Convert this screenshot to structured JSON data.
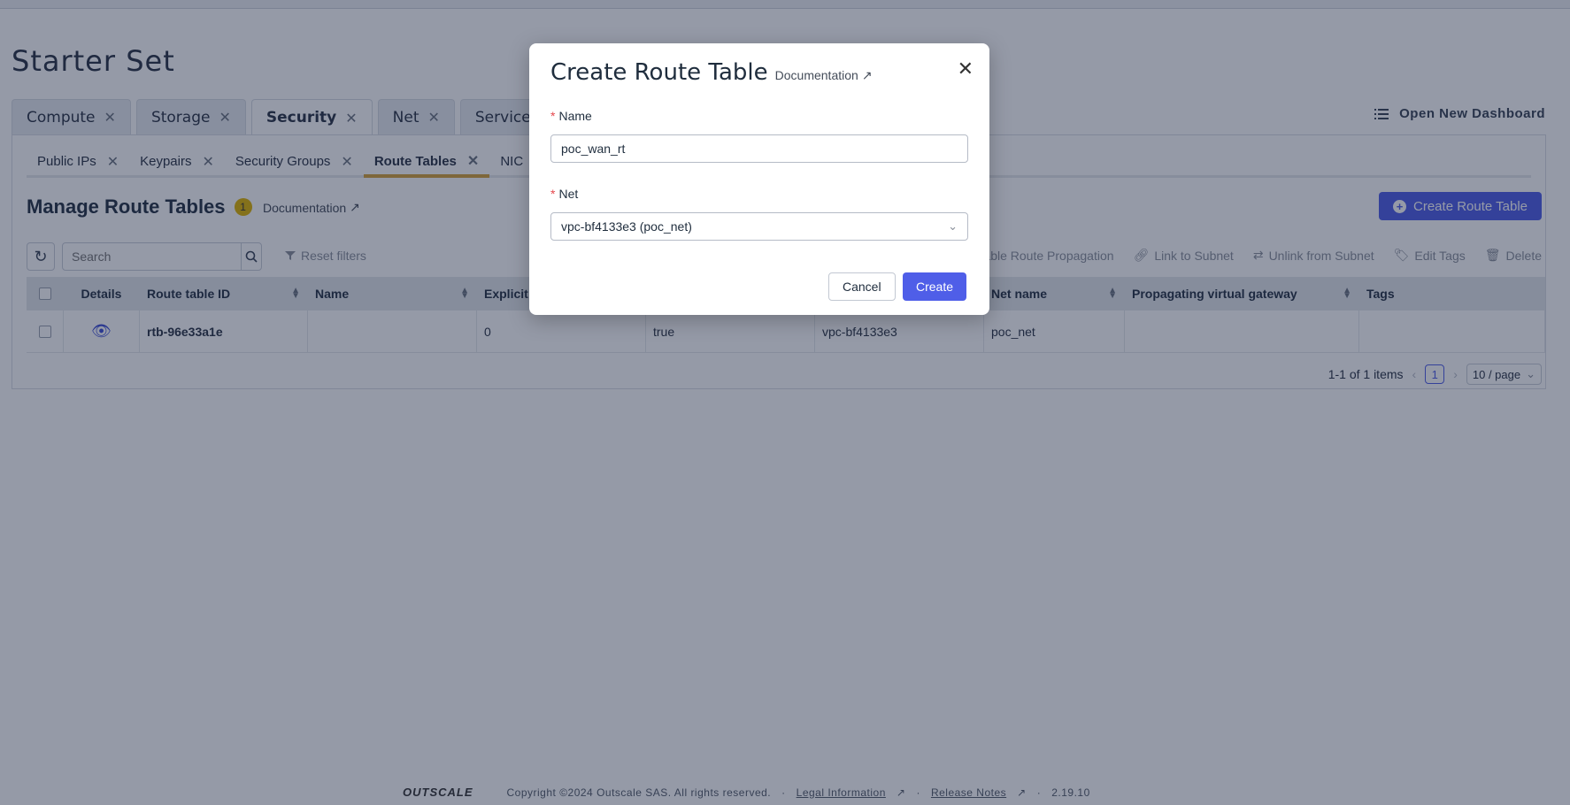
{
  "page": {
    "title": "Starter Set"
  },
  "dashboard_tabs": [
    {
      "label": "Compute"
    },
    {
      "label": "Storage"
    },
    {
      "label": "Security"
    },
    {
      "label": "Net"
    },
    {
      "label": "Services"
    }
  ],
  "open_new_dashboard": "Open New Dashboard",
  "sub_tabs": [
    {
      "label": "Public IPs"
    },
    {
      "label": "Keypairs"
    },
    {
      "label": "Security Groups"
    },
    {
      "label": "Route Tables"
    },
    {
      "label": "NIC"
    }
  ],
  "manage": {
    "title": "Manage Route Tables",
    "badge": "1",
    "documentation": "Documentation",
    "create_button": "Create Route Table"
  },
  "toolbar": {
    "search_placeholder": "Search",
    "reset_filters": "Reset filters",
    "actions": [
      "sable Route Propagation",
      "Link to Subnet",
      "Unlink from Subnet",
      "Edit Tags",
      "Delete"
    ]
  },
  "table": {
    "headers": [
      "Details",
      "Route table ID",
      "Name",
      "Explicit",
      "",
      "",
      "Net name",
      "Propagating virtual gateway",
      "Tags"
    ],
    "rows": [
      [
        "",
        "rtb-96e33a1e",
        "",
        "0",
        "true",
        "vpc-bf4133e3",
        "poc_net",
        "",
        ""
      ]
    ]
  },
  "pagination": {
    "summary": "1-1 of 1 items",
    "current": "1",
    "page_size": "10 / page"
  },
  "footer": {
    "logo": "OUTSCALE",
    "copyright": "Copyright ©2024 Outscale SAS. All rights reserved.",
    "legal": "Legal Information",
    "release": "Release Notes",
    "version": "2.19.10",
    "sep": "·"
  },
  "modal": {
    "title": "Create Route Table",
    "documentation": "Documentation",
    "name_label": "Name",
    "name_value": "poc_wan_rt",
    "net_label": "Net",
    "net_value": "vpc-bf4133e3 (poc_net)",
    "cancel": "Cancel",
    "create": "Create",
    "required_mark": "*"
  },
  "colors": {
    "primary": "#4f5ee8",
    "accent": "#d6a23a",
    "badge": "#e0b400",
    "required": "#e5484d"
  }
}
